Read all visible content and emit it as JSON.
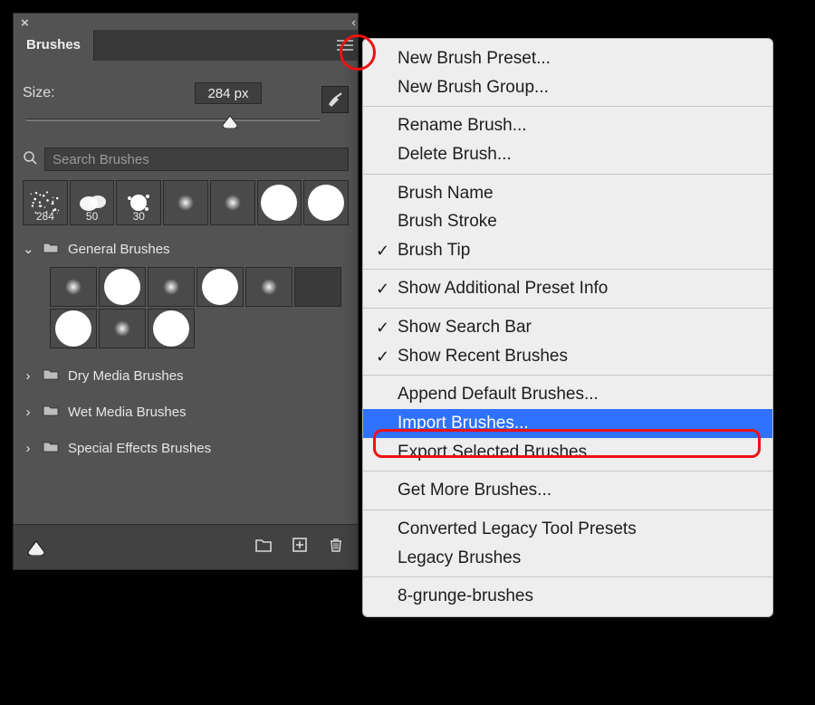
{
  "panel": {
    "tab": "Brushes",
    "size_label": "Size:",
    "size_value": "284 px",
    "slider_pct": 64,
    "search_placeholder": "Search Brushes",
    "recent_thumbs": [
      {
        "label": "284",
        "kind": "sparkle"
      },
      {
        "label": "50",
        "kind": "cloud"
      },
      {
        "label": "30",
        "kind": "splat"
      },
      {
        "label": "",
        "kind": "soft-sm"
      },
      {
        "label": "",
        "kind": "soft-sm"
      },
      {
        "label": "",
        "kind": "hard-lg"
      },
      {
        "label": "",
        "kind": "hard-lg"
      }
    ],
    "groups": [
      {
        "name": "General Brushes",
        "expanded": true,
        "cells": [
          "soft-sm",
          "hard-lg",
          "soft-sm",
          "hard-lg",
          "soft-sm",
          "empty",
          "hard-lg",
          "soft-sm",
          "hard-lg"
        ]
      },
      {
        "name": "Dry Media Brushes",
        "expanded": false
      },
      {
        "name": "Wet Media Brushes",
        "expanded": false
      },
      {
        "name": "Special Effects Brushes",
        "expanded": false
      }
    ]
  },
  "menu": {
    "sections": [
      [
        {
          "label": "New Brush Preset..."
        },
        {
          "label": "New Brush Group..."
        }
      ],
      [
        {
          "label": "Rename Brush..."
        },
        {
          "label": "Delete Brush..."
        }
      ],
      [
        {
          "label": "Brush Name"
        },
        {
          "label": "Brush Stroke"
        },
        {
          "label": "Brush Tip",
          "checked": true
        }
      ],
      [
        {
          "label": "Show Additional Preset Info",
          "checked": true
        }
      ],
      [
        {
          "label": "Show Search Bar",
          "checked": true
        },
        {
          "label": "Show Recent Brushes",
          "checked": true
        }
      ],
      [
        {
          "label": "Append Default Brushes..."
        },
        {
          "label": "Import Brushes...",
          "selected": true
        },
        {
          "label": "Export Selected Brushes..."
        }
      ],
      [
        {
          "label": "Get More Brushes..."
        }
      ],
      [
        {
          "label": "Converted Legacy Tool Presets"
        },
        {
          "label": "Legacy Brushes"
        }
      ],
      [
        {
          "label": "8-grunge-brushes"
        }
      ]
    ]
  }
}
